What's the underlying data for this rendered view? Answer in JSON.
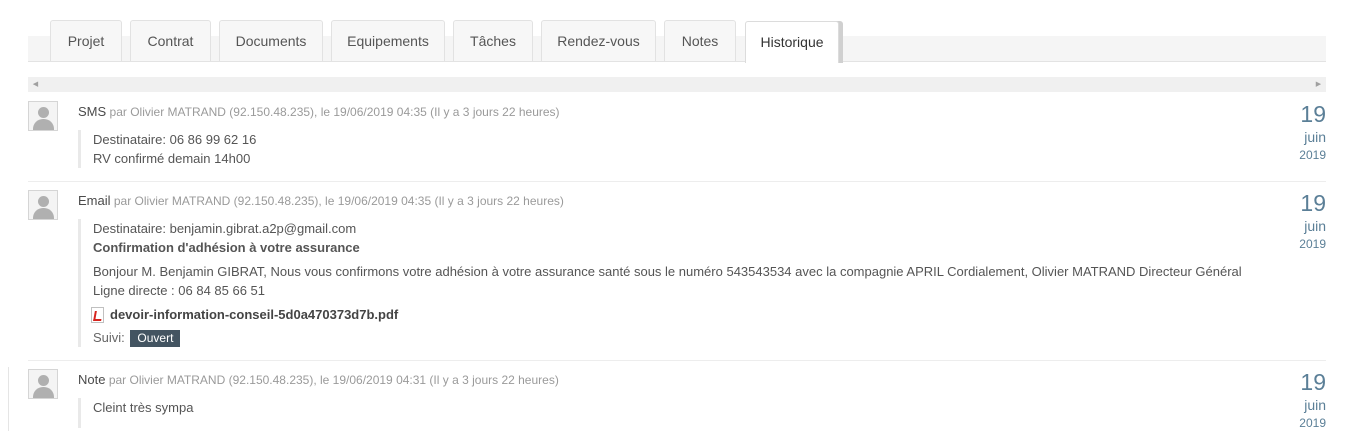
{
  "tabs": [
    {
      "label": "Projet",
      "active": false
    },
    {
      "label": "Contrat",
      "active": false
    },
    {
      "label": "Documents",
      "active": false
    },
    {
      "label": "Equipements",
      "active": false
    },
    {
      "label": "Tâches",
      "active": false
    },
    {
      "label": "Rendez-vous",
      "active": false
    },
    {
      "label": "Notes",
      "active": false
    },
    {
      "label": "Historique",
      "active": true
    }
  ],
  "scrollbar": {
    "left_arrow": "◀",
    "right_arrow": "▶"
  },
  "entries": [
    {
      "type": "SMS",
      "meta": "par Olivier MATRAND (92.150.48.235), le 19/06/2019 04:35 (Il y a 3 jours 22 heures)",
      "lines": [
        "Destinataire: 06 86 99 62 16",
        "RV confirmé demain 14h00"
      ],
      "date": {
        "day": "19",
        "month": "juin",
        "year": "2019"
      }
    },
    {
      "type": "Email",
      "meta": "par Olivier MATRAND (92.150.48.235), le 19/06/2019 04:35 (Il y a 3 jours 22 heures)",
      "recipient": "Destinataire: benjamin.gibrat.a2p@gmail.com",
      "subject": "Confirmation d'adhésion à votre assurance",
      "body_line1": "Bonjour M. Benjamin GIBRAT, Nous vous confirmons votre adhésion à votre assurance santé sous le numéro 543543534 avec la compagnie APRIL Cordialement, Olivier MATRAND Directeur Général",
      "body_line2": "Ligne directe : 06 84 85 66 51",
      "attachment": "devoir-information-conseil-5d0a470373d7b.pdf",
      "suivi_label": "Suivi:",
      "suivi_status": "Ouvert",
      "date": {
        "day": "19",
        "month": "juin",
        "year": "2019"
      }
    },
    {
      "type": "Note",
      "meta": "par Olivier MATRAND (92.150.48.235), le 19/06/2019 04:31 (Il y a 3 jours 22 heures)",
      "lines": [
        "Cleint très sympa"
      ],
      "date": {
        "day": "19",
        "month": "juin",
        "year": "2019"
      }
    }
  ]
}
